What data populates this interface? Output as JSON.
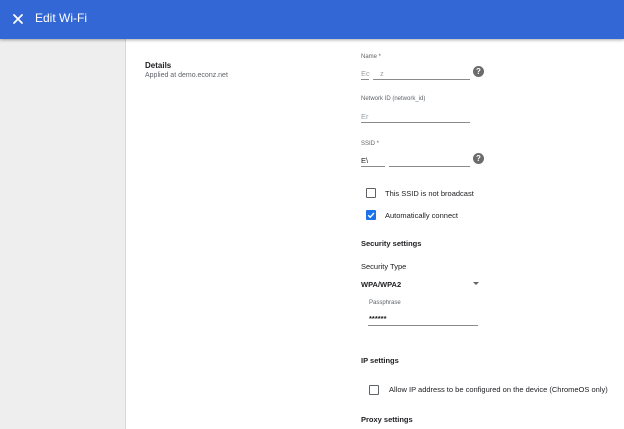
{
  "header": {
    "title": "Edit Wi-Fi",
    "close_icon": "close-icon"
  },
  "details": {
    "title": "Details",
    "subtitle": "Applied at demo.econz.net"
  },
  "name_field": {
    "label": "Name *",
    "value_left": "Ec",
    "value_right": "z"
  },
  "network_id_field": {
    "label": "Network ID (network_id)",
    "value": "Er"
  },
  "ssid_field": {
    "label": "SSID *",
    "value": "E\\"
  },
  "checkboxes": {
    "not_broadcast": {
      "label": "This SSID is not broadcast",
      "checked": false
    },
    "auto_connect": {
      "label": "Automatically connect",
      "checked": true
    }
  },
  "security": {
    "heading": "Security settings",
    "type_label": "Security Type",
    "type_value": "WPA/WPA2",
    "passphrase_label": "Passphrase",
    "passphrase_value": "******"
  },
  "ip": {
    "heading": "IP settings",
    "allow_label": "Allow IP address to be configured on the device (ChromeOS only)",
    "allow_checked": false
  },
  "proxy": {
    "heading": "Proxy settings"
  },
  "colors": {
    "header": "#3367d6",
    "checkbox_checked": "#1a73e8"
  }
}
